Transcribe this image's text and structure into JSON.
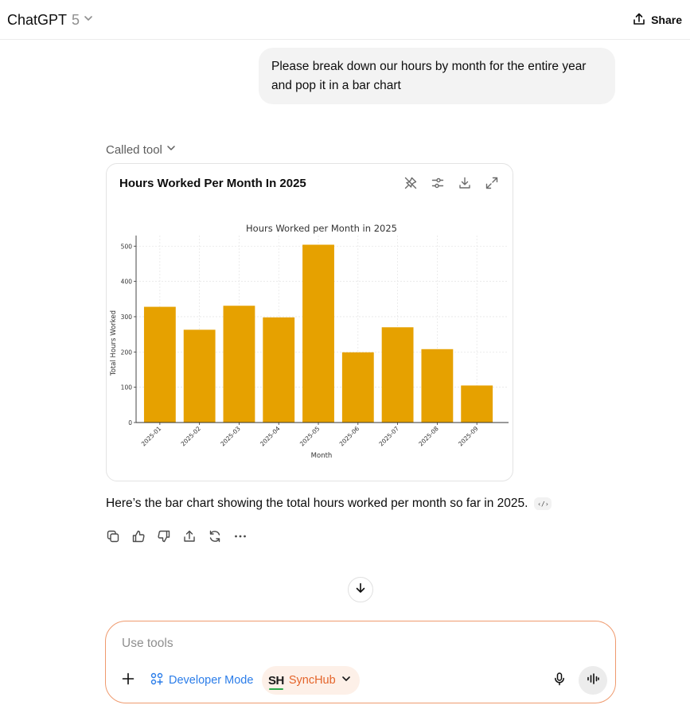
{
  "header": {
    "model_name": "ChatGPT",
    "model_version": "5",
    "share_label": "Share"
  },
  "user_message": {
    "text": "Please break down our hours by month for the entire year and pop it in a bar chart"
  },
  "tool_call": {
    "label": "Called tool"
  },
  "chart_card": {
    "title": "Hours Worked Per Month In 2025",
    "actions": [
      "pin-off-icon",
      "sliders-icon",
      "download-icon",
      "expand-icon"
    ]
  },
  "chart_data": {
    "type": "bar",
    "title": "Hours Worked per Month in 2025",
    "xlabel": "Month",
    "ylabel": "Total Hours Worked",
    "categories": [
      "2025-01",
      "2025-02",
      "2025-03",
      "2025-04",
      "2025-05",
      "2025-06",
      "2025-07",
      "2025-08",
      "2025-09"
    ],
    "values": [
      328,
      263,
      331,
      298,
      504,
      199,
      270,
      208,
      105
    ],
    "ylim": [
      0,
      530
    ],
    "yticks": [
      0,
      100,
      200,
      300,
      400,
      500
    ],
    "bar_color": "#e6a100",
    "grid": true
  },
  "assistant_message": {
    "text": "Here’s the bar chart showing the total hours worked per month so far in 2025.",
    "code_chip": "‹/›"
  },
  "message_actions": [
    "copy-icon",
    "thumbs-up-icon",
    "thumbs-down-icon",
    "share-icon",
    "regenerate-icon",
    "more-icon"
  ],
  "composer": {
    "placeholder": "Use tools",
    "developer_mode_label": "Developer Mode",
    "connector_logo": "SH",
    "connector_label": "SyncHub",
    "accent_color": "#ef9a6e",
    "link_color": "#2b7de9"
  }
}
